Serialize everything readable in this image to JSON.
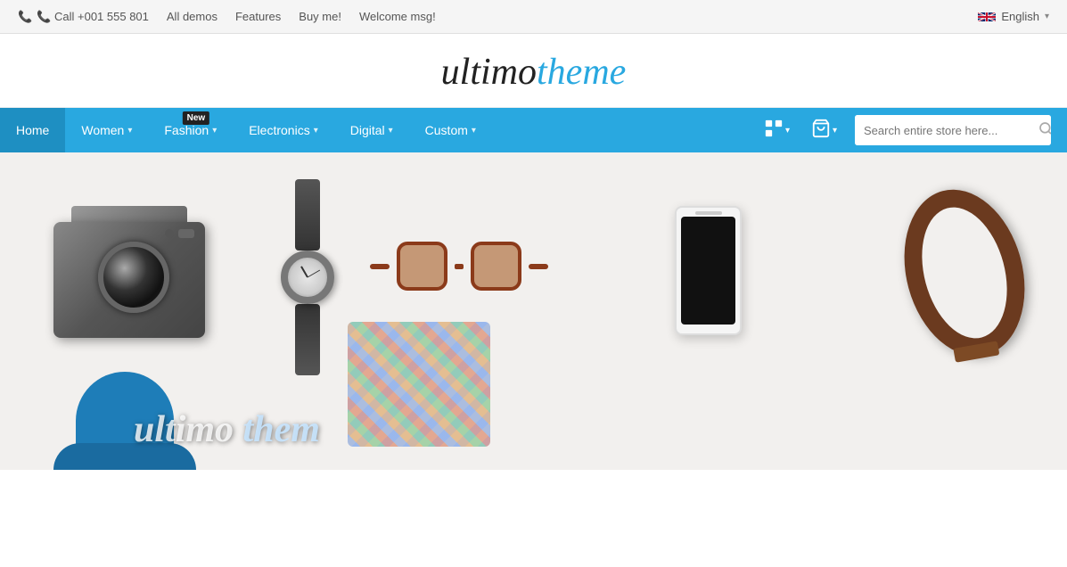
{
  "topbar": {
    "phone": "📞 Call +001 555 801",
    "links": [
      {
        "label": "All demos",
        "href": "#"
      },
      {
        "label": "Features",
        "href": "#"
      },
      {
        "label": "Buy me!",
        "href": "#"
      },
      {
        "label": "Welcome msg!",
        "href": "#"
      }
    ],
    "language": "English",
    "flag_alt": "English flag"
  },
  "logo": {
    "part1": "ultimo",
    "part2": "theme"
  },
  "nav": {
    "items": [
      {
        "label": "Home",
        "active": true,
        "has_dropdown": false,
        "badge": null
      },
      {
        "label": "Women",
        "active": false,
        "has_dropdown": true,
        "badge": null
      },
      {
        "label": "Fashion",
        "active": false,
        "has_dropdown": true,
        "badge": "New"
      },
      {
        "label": "Electronics",
        "active": false,
        "has_dropdown": true,
        "badge": null
      },
      {
        "label": "Digital",
        "active": false,
        "has_dropdown": true,
        "badge": null
      },
      {
        "label": "Custom",
        "active": false,
        "has_dropdown": true,
        "badge": null
      }
    ],
    "compare_icon": "⊟",
    "cart_icon": "🛒",
    "search_placeholder": "Search entire store here..."
  },
  "hero": {
    "text": "ultimo theme"
  }
}
